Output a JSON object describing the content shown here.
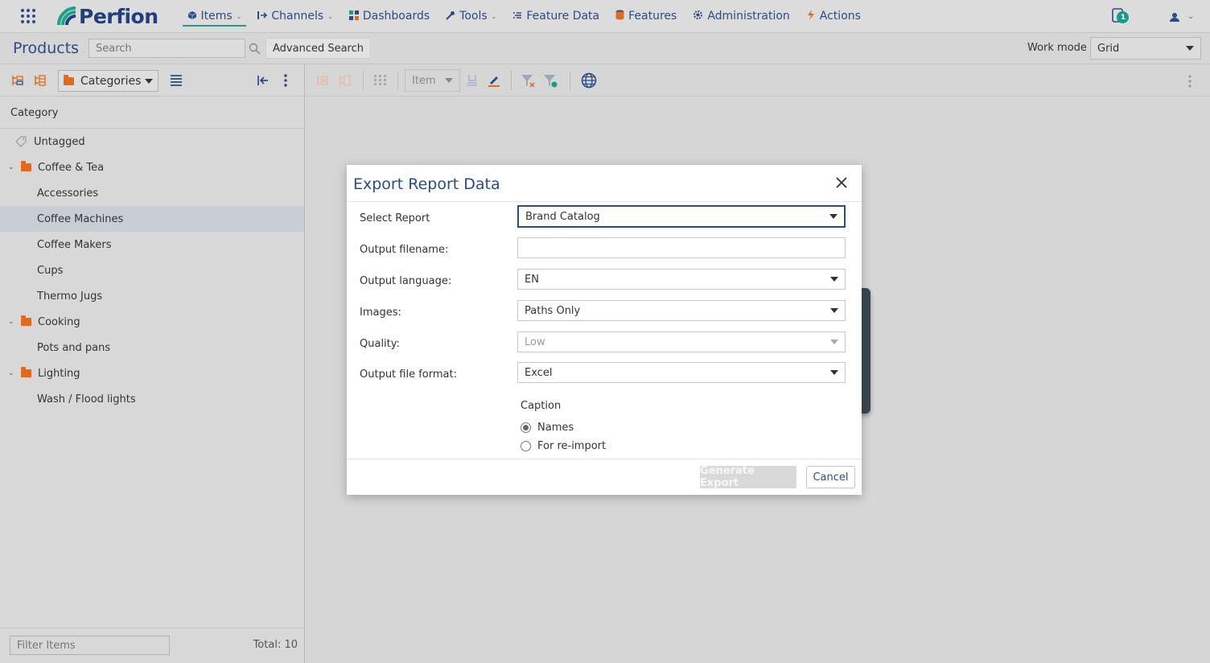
{
  "topnav": {
    "brand": "Perfion",
    "items": [
      {
        "label": "Items",
        "icon": "cube-icon"
      },
      {
        "label": "Channels",
        "icon": "channels-icon"
      },
      {
        "label": "Dashboards",
        "icon": "dashboard-icon"
      },
      {
        "label": "Tools",
        "icon": "wrench-icon"
      },
      {
        "label": "Feature Data",
        "icon": "list-icon"
      },
      {
        "label": "Features",
        "icon": "database-icon"
      },
      {
        "label": "Administration",
        "icon": "gear-icon"
      },
      {
        "label": "Actions",
        "icon": "bolt-icon"
      }
    ],
    "notification_count": "1"
  },
  "toolbar": {
    "page_title": "Products",
    "search_placeholder": "Search",
    "advanced_search": "Advanced Search",
    "work_mode_label": "Work mode",
    "work_mode_value": "Grid"
  },
  "left": {
    "categories_dropdown": "Categories",
    "column_header": "Category",
    "tree": [
      {
        "label": "Untagged",
        "type": "tag",
        "level": 0
      },
      {
        "label": "Coffee & Tea",
        "type": "folder",
        "level": 0,
        "expanded": true
      },
      {
        "label": "Accessories",
        "type": "leaf",
        "level": 1
      },
      {
        "label": "Coffee Machines",
        "type": "leaf",
        "level": 1,
        "selected": true
      },
      {
        "label": "Coffee Makers",
        "type": "leaf",
        "level": 1
      },
      {
        "label": "Cups",
        "type": "leaf",
        "level": 1
      },
      {
        "label": "Thermo Jugs",
        "type": "leaf",
        "level": 1
      },
      {
        "label": "Cooking",
        "type": "folder",
        "level": 0,
        "expanded": true
      },
      {
        "label": "Pots and pans",
        "type": "leaf",
        "level": 1
      },
      {
        "label": "Lighting",
        "type": "folder",
        "level": 0,
        "expanded": true
      },
      {
        "label": "Wash / Flood lights",
        "type": "leaf",
        "level": 1
      }
    ],
    "filter_placeholder": "Filter Items",
    "total": "Total: 10"
  },
  "right_toolbar": {
    "item_dropdown": "Item"
  },
  "modal": {
    "title": "Export Report Data",
    "fields": {
      "select_report": {
        "label": "Select Report",
        "value": "Brand Catalog"
      },
      "output_filename": {
        "label": "Output filename:",
        "value": ""
      },
      "output_language": {
        "label": "Output language:",
        "value": "EN"
      },
      "images": {
        "label": "Images:",
        "value": "Paths Only"
      },
      "quality": {
        "label": "Quality:",
        "value": "Low"
      },
      "output_file_format": {
        "label": "Output file format:",
        "value": "Excel"
      }
    },
    "caption": {
      "title": "Caption",
      "options": [
        "Names",
        "For re-import"
      ],
      "selected": "Names"
    },
    "generate_button": "Generate Export",
    "cancel_button": "Cancel"
  },
  "colors": {
    "brand_blue": "#2b4b86",
    "accent_teal": "#23998a",
    "folder_orange": "#e06a1e"
  }
}
